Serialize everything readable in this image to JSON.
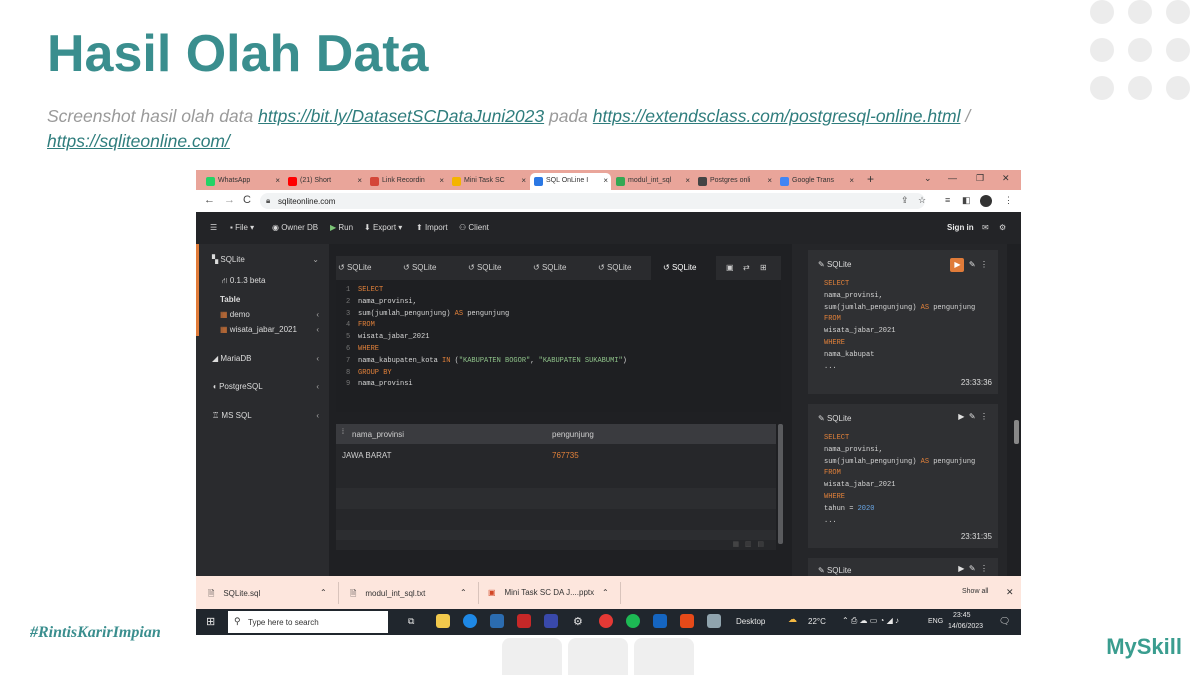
{
  "slide": {
    "title": "Hasil Olah Data",
    "subtitle_prefix": "Screenshot hasil olah data ",
    "link1": "https://bit.ly/DatasetSCDataJuni2023",
    "subtitle_mid": " pada ",
    "link2": "https://extendsclass.com/postgresql-online.html",
    "subtitle_sep": " /",
    "link3": "https://sqliteonline.com/",
    "hashtag": "#RintisKarirImpian",
    "brand": "MySkill"
  },
  "browser": {
    "tabs": [
      {
        "label": "WhatsApp",
        "color": "#25d366"
      },
      {
        "label": "(21) Short",
        "color": "#ff0000"
      },
      {
        "label": "Link Recordin",
        "color": "#d44638"
      },
      {
        "label": "Mini Task SC",
        "color": "#f4b400"
      },
      {
        "label": "SQL OnLine I",
        "color": "#2b78e4",
        "active": true
      },
      {
        "label": "modul_int_sql",
        "color": "#34a853"
      },
      {
        "label": "Postgres onli",
        "color": "#444444"
      },
      {
        "label": "Google Trans",
        "color": "#4285f4"
      }
    ],
    "url": "sqliteonline.com"
  },
  "toolbar": {
    "file": "File",
    "owner_db": "Owner DB",
    "run": "Run",
    "export": "Export",
    "import": "Import",
    "client": "Client",
    "sign_in": "Sign in"
  },
  "sidebar": {
    "sqlite": "SQLite",
    "version": "0.1.3 beta",
    "table": "Table",
    "tables": [
      "demo",
      "wisata_jabar_2021"
    ],
    "mariadb": "MariaDB",
    "postgresql": "PostgreSQL",
    "mssql": "MS SQL"
  },
  "editor_tabs": [
    "SQLite",
    "SQLite",
    "SQLite",
    "SQLite",
    "SQLite",
    "SQLite"
  ],
  "query": {
    "lines": [
      {
        "n": "1",
        "parts": [
          {
            "t": "SELECT",
            "c": "kw"
          }
        ]
      },
      {
        "n": "2",
        "parts": [
          {
            "t": "nama_provinsi,",
            "c": ""
          }
        ]
      },
      {
        "n": "3",
        "parts": [
          {
            "t": "sum(jumlah_pengunjung) ",
            "c": ""
          },
          {
            "t": "AS",
            "c": "kw"
          },
          {
            "t": " pengunjung",
            "c": ""
          }
        ]
      },
      {
        "n": "4",
        "parts": [
          {
            "t": "FROM",
            "c": "kw"
          }
        ]
      },
      {
        "n": "5",
        "parts": [
          {
            "t": "wisata_jabar_2021",
            "c": ""
          }
        ]
      },
      {
        "n": "6",
        "parts": [
          {
            "t": "WHERE",
            "c": "kw"
          }
        ]
      },
      {
        "n": "7",
        "parts": [
          {
            "t": "nama_kabupaten_kota ",
            "c": ""
          },
          {
            "t": "IN",
            "c": "kw"
          },
          {
            "t": " (",
            "c": ""
          },
          {
            "t": "\"KABUPATEN BOGOR\"",
            "c": "str"
          },
          {
            "t": ", ",
            "c": ""
          },
          {
            "t": "\"KABUPATEN SUKABUMI\"",
            "c": "str"
          },
          {
            "t": ")",
            "c": ""
          }
        ]
      },
      {
        "n": "8",
        "parts": [
          {
            "t": "GROUP BY",
            "c": "kw"
          }
        ]
      },
      {
        "n": "9",
        "parts": [
          {
            "t": "nama_provinsi",
            "c": ""
          }
        ]
      }
    ]
  },
  "results": {
    "columns": [
      "nama_provinsi",
      "pengunjung"
    ],
    "rows": [
      [
        "JAWA BARAT",
        "767735"
      ]
    ]
  },
  "history": [
    {
      "label": "SQLite",
      "time": "23:33:36",
      "lines": [
        [
          {
            "t": "SELECT",
            "c": "kw"
          }
        ],
        [
          {
            "t": "nama_provinsi,",
            "c": ""
          }
        ],
        [
          {
            "t": "sum(jumlah_pengunjung) ",
            "c": ""
          },
          {
            "t": "AS",
            "c": "kw"
          },
          {
            "t": " pengunjung",
            "c": ""
          }
        ],
        [
          {
            "t": "FROM",
            "c": "kw"
          }
        ],
        [
          {
            "t": "wisata_jabar_2021",
            "c": ""
          }
        ],
        [
          {
            "t": "WHERE",
            "c": "kw"
          }
        ],
        [
          {
            "t": "nama_kabupat",
            "c": ""
          }
        ],
        [
          {
            "t": "...",
            "c": ""
          }
        ]
      ]
    },
    {
      "label": "SQLite",
      "time": "23:31:35",
      "lines": [
        [
          {
            "t": "SELECT",
            "c": "kw"
          }
        ],
        [
          {
            "t": "nama_provinsi,",
            "c": ""
          }
        ],
        [
          {
            "t": "sum(jumlah_pengunjung) ",
            "c": ""
          },
          {
            "t": "AS",
            "c": "kw"
          },
          {
            "t": " pengunjung",
            "c": ""
          }
        ],
        [
          {
            "t": "FROM",
            "c": "kw"
          }
        ],
        [
          {
            "t": "wisata_jabar_2021",
            "c": ""
          }
        ],
        [
          {
            "t": "WHERE",
            "c": "kw"
          }
        ],
        [
          {
            "t": "tahun = ",
            "c": ""
          },
          {
            "t": "2020",
            "c": "num"
          }
        ],
        [
          {
            "t": "...",
            "c": ""
          }
        ]
      ]
    }
  ],
  "history_partial_label": "SQLite",
  "downloads": {
    "items": [
      "SQLite.sql",
      "modul_int_sql.txt",
      "Mini Task SC DA J....pptx"
    ],
    "show_all": "Show all"
  },
  "taskbar": {
    "search_placeholder": "Type here to search",
    "desktop": "Desktop",
    "weather": "22°C",
    "lang": "ENG",
    "time": "23:45",
    "date": "14/06/2023"
  }
}
